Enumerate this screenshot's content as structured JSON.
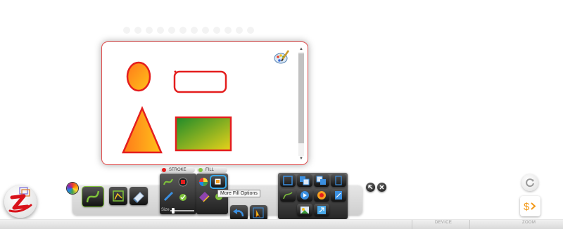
{
  "canvas": {
    "scroll_up": "▲",
    "scroll_down": "▼"
  },
  "toolbar": {
    "stroke_label": "STROKE",
    "fill_label": "FILL",
    "size_label": "Size",
    "tooltip": "More Fill Options"
  },
  "statusbar": {
    "left_label": "DEVICE",
    "right_label": "ZOOM"
  },
  "colors": {
    "canvas_border": "#e05050",
    "shape_stroke": "#e41e1e",
    "gradient_orange_start": "#ff7a1a",
    "gradient_orange_end": "#ffc21a",
    "gradient_green_start": "#1e8a2a",
    "gradient_green_end": "#e8d21a",
    "selection_highlight": "#38a8e8"
  },
  "icons": [
    "palette-brush-icon",
    "zwibbler-logo-icon",
    "color-wheel-icon",
    "curve-tool-icon",
    "shape-tool-icon",
    "eraser-icon",
    "undo-icon",
    "pointer-icon",
    "refresh-icon",
    "dollar-share-icon"
  ]
}
